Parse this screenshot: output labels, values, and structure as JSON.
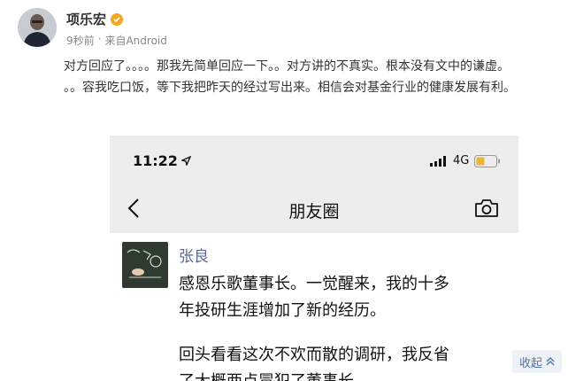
{
  "post": {
    "author": "项乐宏",
    "time": "9秒前",
    "separator": "·",
    "source": "来自Android",
    "lines": [
      "对方回应了。。。。那我先简单回应一下。。对方讲的不真实。根本没有文中的谦虚。",
      "。。容我吃口饭，等下我把昨天的经过写出来。相信会对基金行业的健康发展有利。"
    ],
    "verified_icon": "verified-badge-icon"
  },
  "screenshot": {
    "status_time": "11:22",
    "location_icon": "location-arrow-icon",
    "network": "4G",
    "nav_title": "朋友圈",
    "back_icon": "chevron-left-icon",
    "camera_icon": "camera-icon",
    "moment": {
      "name": "张良",
      "lines": [
        "感恩乐歌董事长。一觉醒来，我的十多",
        "年投研生涯增加了新的经历。",
        "回头看看这次不欢而散的调研，我反省",
        "了大概两点冒犯了董事长。"
      ]
    }
  },
  "collapse": {
    "label": "收起",
    "icon": "double-chevron-up-icon"
  },
  "colors": {
    "link_blue": "#576b95",
    "verified_orange": "#f5a623",
    "collapse_text": "#4a74a8"
  }
}
